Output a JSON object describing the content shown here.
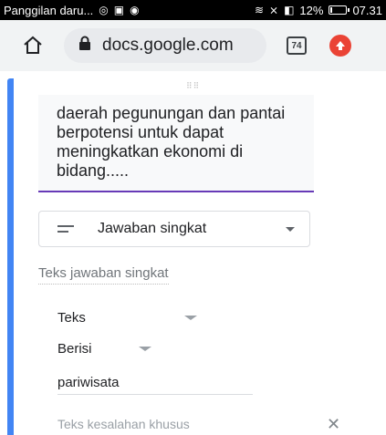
{
  "status_bar": {
    "notification": "Panggilan daru...",
    "battery": "12%",
    "battery_level": 0.12,
    "time": "07.31"
  },
  "browser": {
    "home_icon": "home-icon",
    "lock_icon": "lock-icon",
    "url": "docs.google.com",
    "tab_count": "74",
    "extension_icon": "red-extension-icon"
  },
  "question": {
    "text": "daerah pegunungan dan pantai berpotensi untuk dapat meningkatkan ekonomi di bidang....."
  },
  "question_type": {
    "selected": "Jawaban singkat"
  },
  "answer": {
    "placeholder": "Teks jawaban singkat"
  },
  "validation": {
    "type": "Teks",
    "condition": "Berisi",
    "value": "pariwisata",
    "error_placeholder": "Teks kesalahan khusus"
  },
  "colors": {
    "accent": "#4285f4",
    "question_underline": "#673ab7"
  }
}
